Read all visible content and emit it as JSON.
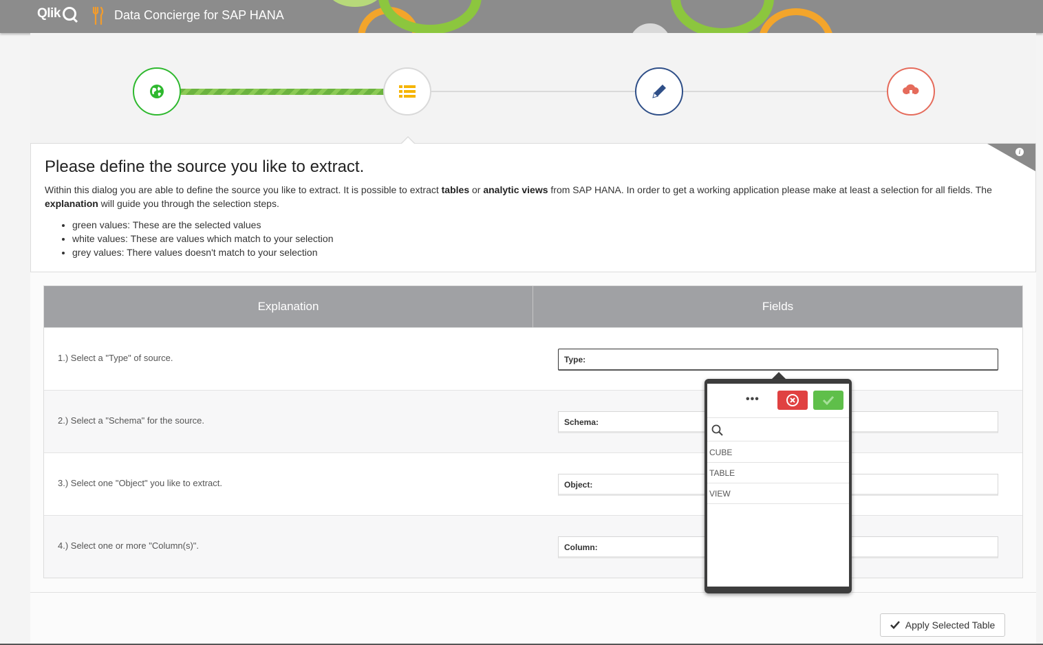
{
  "header": {
    "brand": "Qlik",
    "app_title": "Data Concierge for SAP HANA"
  },
  "stepper": {
    "steps": [
      {
        "icon": "globe-icon",
        "color": "#2eb82e",
        "state": "done"
      },
      {
        "icon": "list-icon",
        "color": "#f5b400",
        "state": "current"
      },
      {
        "icon": "pencil-icon",
        "color": "#2f4f88",
        "state": "pending"
      },
      {
        "icon": "cloud-download-icon",
        "color": "#e56b5b",
        "state": "pending"
      }
    ]
  },
  "info": {
    "title": "Please define the source you like to extract.",
    "para_1": "Within this dialog you are able to define the source you like to extract. It is possible to extract ",
    "para_b1": "tables",
    "para_2": " or ",
    "para_b2": "analytic views",
    "para_3": " from SAP HANA. In order to get a working application please make at least a selection for all fields. The ",
    "para_b3": "explanation",
    "para_4": " will guide you through the selection steps.",
    "bullets": [
      "green values: These are the selected values",
      "white values: These are values which match to your selection",
      "grey values: There values doesn't match to your selection"
    ]
  },
  "table": {
    "headers": [
      "Explanation",
      "Fields"
    ],
    "rows": [
      {
        "explanation": "1.) Select a \"Type\" of source.",
        "field": "Type:"
      },
      {
        "explanation": "2.) Select a \"Schema\" for the source.",
        "field": "Schema:"
      },
      {
        "explanation": "3.) Select one \"Object\" you like to extract.",
        "field": "Object:"
      },
      {
        "explanation": "4.) Select one or more \"Column(s)\".",
        "field": "Column:"
      }
    ]
  },
  "popup": {
    "more": "•••",
    "search_placeholder": "",
    "options": [
      "CUBE",
      "TABLE",
      "VIEW"
    ]
  },
  "footer": {
    "apply_label": "Apply Selected Table"
  },
  "colors": {
    "header_bg": "#8c8c8c",
    "accent_green": "#5fbf4a",
    "accent_red": "#e04141"
  }
}
